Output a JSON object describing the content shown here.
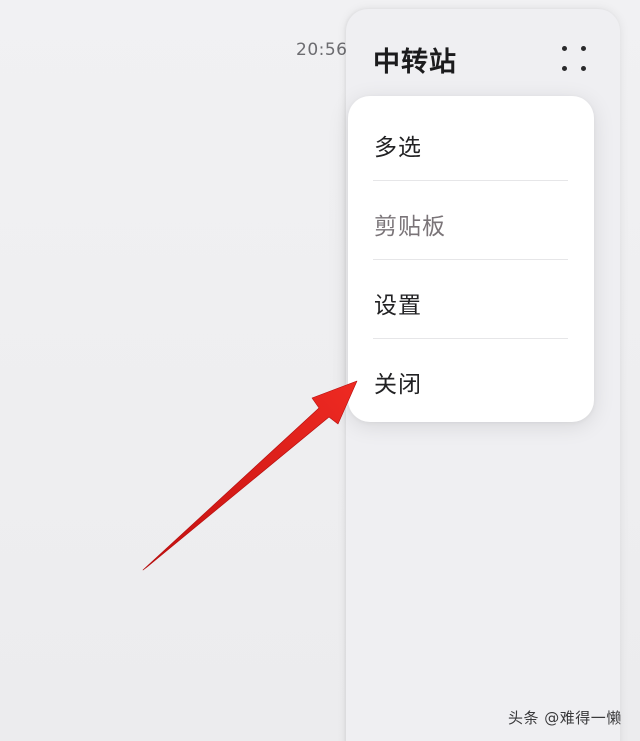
{
  "status": {
    "time": "20:56"
  },
  "panel": {
    "title": "中转站",
    "more_icon": "four-dots-icon"
  },
  "menu": {
    "items": [
      {
        "label": "多选",
        "state": "normal"
      },
      {
        "label": "剪贴板",
        "state": "muted"
      },
      {
        "label": "设置",
        "state": "normal"
      },
      {
        "label": "关闭",
        "state": "normal"
      }
    ]
  },
  "annotation": {
    "arrow_icon": "red-arrow-icon",
    "arrow_color": "#e01b1b"
  },
  "watermark": {
    "text": "头条 @难得一懒"
  }
}
